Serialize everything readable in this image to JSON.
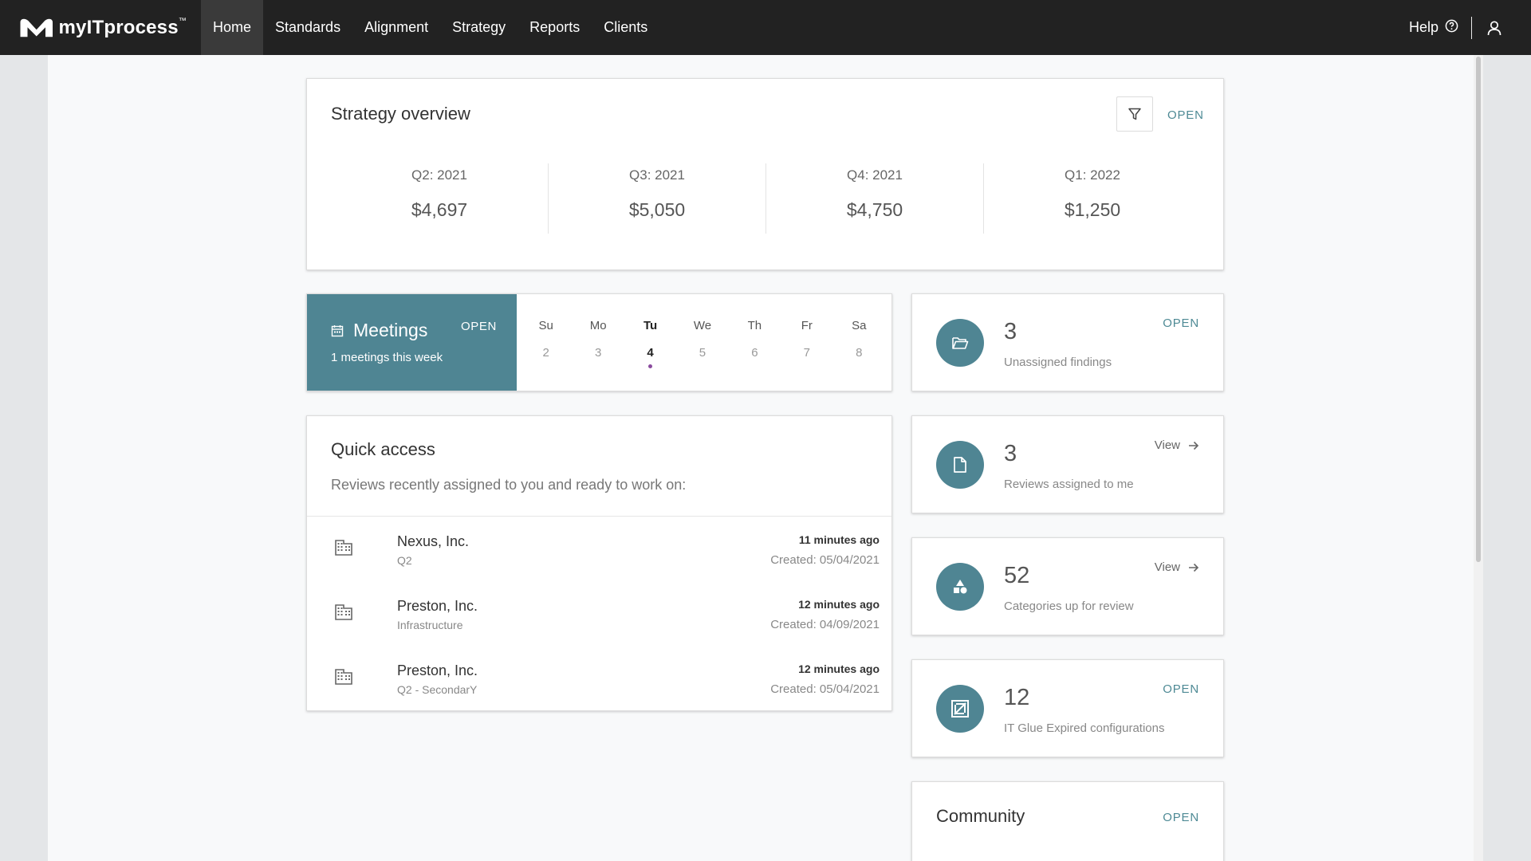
{
  "app": {
    "logo_text": "myITprocess",
    "logo_tm": "™"
  },
  "nav": {
    "items": [
      {
        "label": "Home"
      },
      {
        "label": "Standards"
      },
      {
        "label": "Alignment"
      },
      {
        "label": "Strategy"
      },
      {
        "label": "Reports"
      },
      {
        "label": "Clients"
      }
    ],
    "active": "Home",
    "help_label": "Help"
  },
  "strategy": {
    "title": "Strategy overview",
    "open_label": "OPEN",
    "quarters": [
      {
        "label": "Q2: 2021",
        "value": "$4,697"
      },
      {
        "label": "Q3: 2021",
        "value": "$5,050"
      },
      {
        "label": "Q4: 2021",
        "value": "$4,750"
      },
      {
        "label": "Q1: 2022",
        "value": "$1,250"
      }
    ]
  },
  "meetings": {
    "title": "Meetings",
    "open_label": "OPEN",
    "subtitle": "1 meetings this week",
    "days": [
      {
        "name": "Su",
        "num": "2"
      },
      {
        "name": "Mo",
        "num": "3"
      },
      {
        "name": "Tu",
        "num": "4"
      },
      {
        "name": "We",
        "num": "5"
      },
      {
        "name": "Th",
        "num": "6"
      },
      {
        "name": "Fr",
        "num": "7"
      },
      {
        "name": "Sa",
        "num": "8"
      }
    ],
    "today": "Tu"
  },
  "quick_access": {
    "title": "Quick access",
    "subtitle": "Reviews recently assigned to you and ready to work on:",
    "items": [
      {
        "name": "Nexus, Inc.",
        "tag": "Q2",
        "time": "11 minutes ago",
        "created": "Created: 05/04/2021"
      },
      {
        "name": "Preston, Inc.",
        "tag": "Infrastructure",
        "time": "12 minutes ago",
        "created": "Created: 04/09/2021"
      },
      {
        "name": "Preston, Inc.",
        "tag": "Q2 - SecondarY",
        "time": "12 minutes ago",
        "created": "Created: 05/04/2021"
      }
    ]
  },
  "stats": {
    "findings": {
      "count": "3",
      "label": "Unassigned findings",
      "link": "OPEN",
      "icon": "folder-open-icon"
    },
    "reviews": {
      "count": "3",
      "label": "Reviews assigned to me",
      "link": "View",
      "icon": "document-icon"
    },
    "categories": {
      "count": "52",
      "label": "Categories up for review",
      "link": "View",
      "icon": "shapes-icon"
    },
    "itglue": {
      "count": "12",
      "label": "IT Glue Expired configurations",
      "link": "OPEN",
      "icon": "it-glue-icon"
    }
  },
  "community": {
    "title": "Community",
    "open_label": "OPEN"
  },
  "colors": {
    "topbar": "#222222",
    "accent": "#4f8593",
    "link": "#4e8a95",
    "today_dot": "#8a4b9e",
    "background": "#e4e6e8",
    "surface": "#f8f9fa"
  }
}
